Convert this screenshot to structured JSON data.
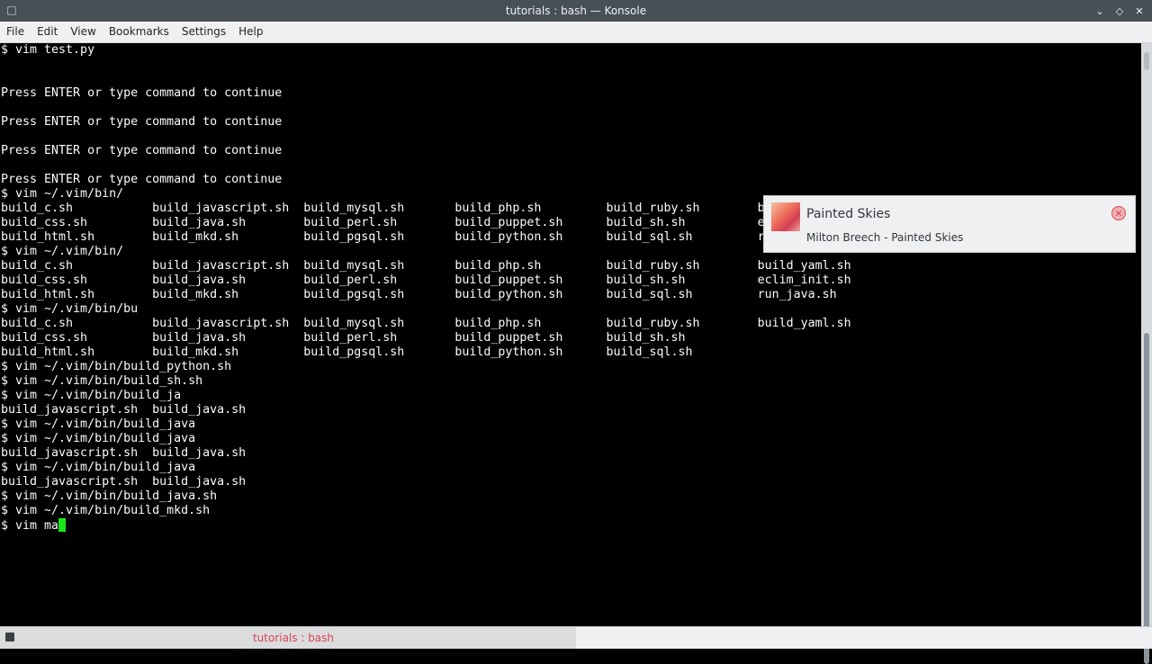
{
  "window": {
    "title": "tutorials : bash — Konsole",
    "app_icon": "terminal-icon",
    "controls": [
      "minimize-icon",
      "restore-icon",
      "close-icon"
    ]
  },
  "menubar": {
    "items": [
      "File",
      "Edit",
      "View",
      "Bookmarks",
      "Settings",
      "Help"
    ]
  },
  "terminal": {
    "lines": [
      "$ vim test.py",
      "",
      "",
      "Press ENTER or type command to continue",
      "",
      "Press ENTER or type command to continue",
      "",
      "Press ENTER or type command to continue",
      "",
      "Press ENTER or type command to continue",
      "$ vim ~/.vim/bin/",
      "build_c.sh           build_javascript.sh  build_mysql.sh       build_php.sh         build_ruby.sh        build_yaml.sh",
      "build_css.sh         build_java.sh        build_perl.sh        build_puppet.sh      build_sh.sh          eclim_init.sh",
      "build_html.sh        build_mkd.sh         build_pgsql.sh       build_python.sh      build_sql.sh         run_java.sh",
      "$ vim ~/.vim/bin/",
      "build_c.sh           build_javascript.sh  build_mysql.sh       build_php.sh         build_ruby.sh        build_yaml.sh",
      "build_css.sh         build_java.sh        build_perl.sh        build_puppet.sh      build_sh.sh          eclim_init.sh",
      "build_html.sh        build_mkd.sh         build_pgsql.sh       build_python.sh      build_sql.sh         run_java.sh",
      "$ vim ~/.vim/bin/bu",
      "build_c.sh           build_javascript.sh  build_mysql.sh       build_php.sh         build_ruby.sh        build_yaml.sh",
      "build_css.sh         build_java.sh        build_perl.sh        build_puppet.sh      build_sh.sh",
      "build_html.sh        build_mkd.sh         build_pgsql.sh       build_python.sh      build_sql.sh",
      "$ vim ~/.vim/bin/build_python.sh",
      "$ vim ~/.vim/bin/build_sh.sh",
      "$ vim ~/.vim/bin/build_ja",
      "build_javascript.sh  build_java.sh",
      "$ vim ~/.vim/bin/build_java",
      "$ vim ~/.vim/bin/build_java",
      "build_javascript.sh  build_java.sh",
      "$ vim ~/.vim/bin/build_java",
      "build_javascript.sh  build_java.sh",
      "$ vim ~/.vim/bin/build_java.sh",
      "$ vim ~/.vim/bin/build_mkd.sh"
    ],
    "prompt_line": "$ vim ma",
    "cursor_color": "#19e619"
  },
  "notification": {
    "title": "Painted Skies",
    "body": "Milton Breech - Painted Skies",
    "icon": "album-art-icon",
    "close_icon": "close-circle-icon"
  },
  "tabbar": {
    "active_tab_label": "tutorials : bash",
    "active_tab_color": "#da4453"
  },
  "colors": {
    "terminal_bg": "#000000",
    "terminal_fg": "#fcfcfc",
    "titlebar_bg": "#475057"
  }
}
